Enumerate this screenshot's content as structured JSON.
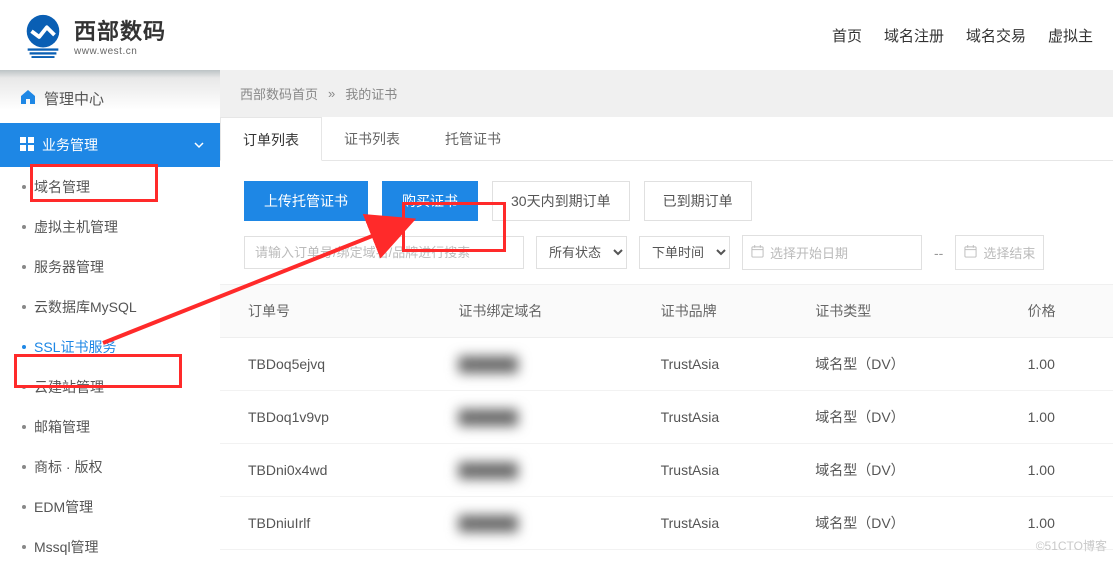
{
  "header": {
    "logo_cn": "西部数码",
    "logo_en": "www.west.cn",
    "nav": [
      "首页",
      "域名注册",
      "域名交易",
      "虚拟主"
    ]
  },
  "sidebar": {
    "home": "管理中心",
    "section": "业务管理",
    "items": [
      {
        "label": "域名管理",
        "active": false
      },
      {
        "label": "虚拟主机管理",
        "active": false
      },
      {
        "label": "服务器管理",
        "active": false
      },
      {
        "label": "云数据库MySQL",
        "active": false
      },
      {
        "label": "SSL证书服务",
        "active": true
      },
      {
        "label": "云建站管理",
        "active": false
      },
      {
        "label": "邮箱管理",
        "active": false
      },
      {
        "label": "商标 · 版权",
        "active": false
      },
      {
        "label": "EDM管理",
        "active": false
      },
      {
        "label": "Mssql管理",
        "active": false
      }
    ]
  },
  "breadcrumb": {
    "root": "西部数码首页",
    "sep": "»",
    "current": "我的证书"
  },
  "tabs": [
    {
      "label": "订单列表",
      "active": true
    },
    {
      "label": "证书列表",
      "active": false
    },
    {
      "label": "托管证书",
      "active": false
    }
  ],
  "toolbar": {
    "upload": "上传托管证书",
    "buy": "购买证书",
    "expiring30": "30天内到期订单",
    "expired": "已到期订单"
  },
  "filters": {
    "search_placeholder": "请输入订单号/绑定域名/品牌进行搜索",
    "status_label": "所有状态",
    "time_label": "下单时间",
    "date_start_placeholder": "选择开始日期",
    "date_sep": "--",
    "date_end_placeholder": "选择结束"
  },
  "table": {
    "columns": [
      "订单号",
      "证书绑定域名",
      "证书品牌",
      "证书类型",
      "价格"
    ],
    "rows": [
      {
        "order": "TBDoq5ejvq",
        "domain": "██████",
        "brand": "TrustAsia",
        "type": "域名型（DV）",
        "price": "1.00"
      },
      {
        "order": "TBDoq1v9vp",
        "domain": "██████",
        "brand": "TrustAsia",
        "type": "域名型（DV）",
        "price": "1.00"
      },
      {
        "order": "TBDni0x4wd",
        "domain": "██████",
        "brand": "TrustAsia",
        "type": "域名型（DV）",
        "price": "1.00"
      },
      {
        "order": "TBDniuIrlf",
        "domain": "██████",
        "brand": "TrustAsia",
        "type": "域名型（DV）",
        "price": "1.00"
      }
    ]
  },
  "watermark": "©51CTO博客",
  "colors": {
    "primary": "#1e87e5",
    "anno": "#ff2a2a"
  }
}
